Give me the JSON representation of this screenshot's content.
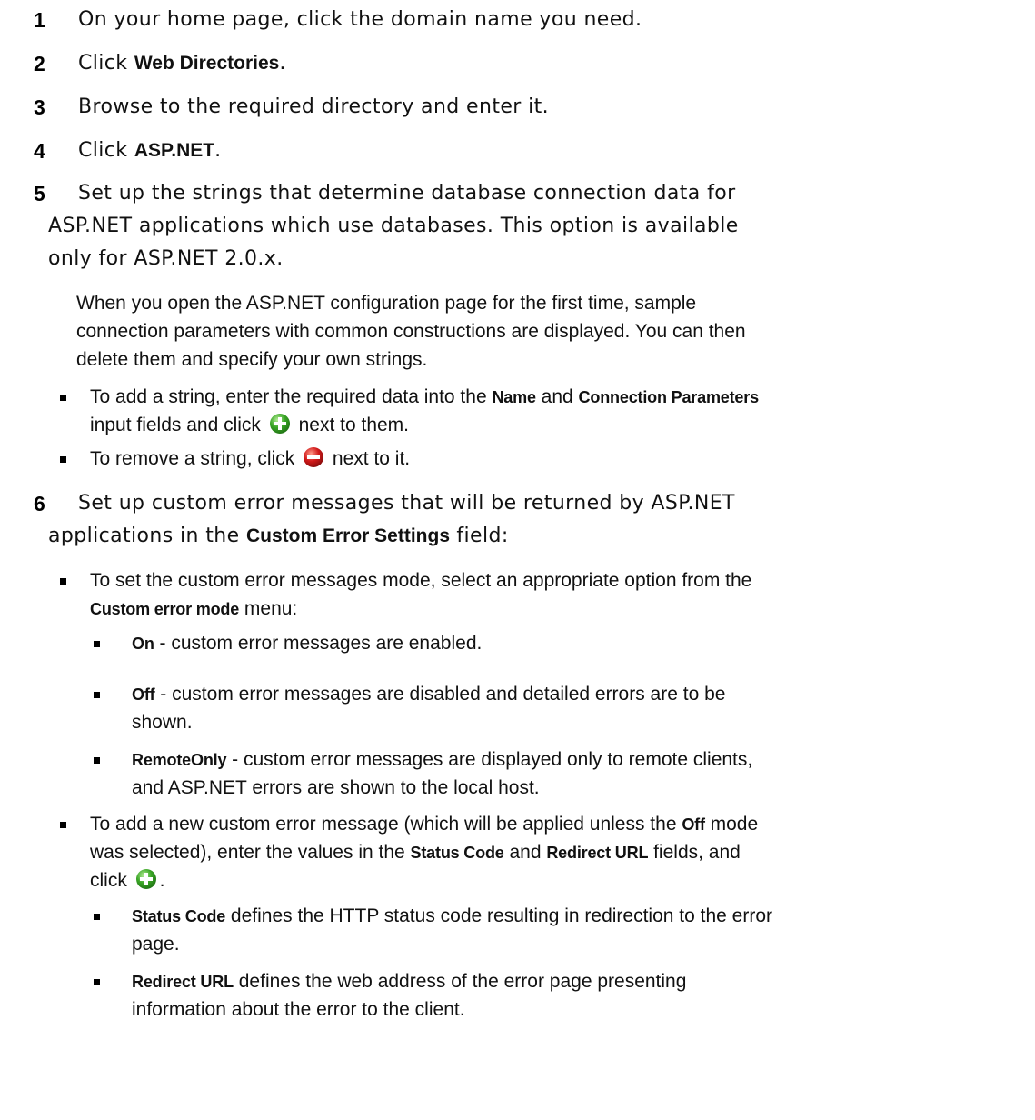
{
  "steps": [
    {
      "number": "1",
      "text": "On your home page, click the domain name you need."
    },
    {
      "number": "2",
      "pre": "Click ",
      "ui": "Web Directories",
      "post": "."
    },
    {
      "number": "3",
      "text": "Browse to the required directory and enter it."
    },
    {
      "number": "4",
      "pre": "Click ",
      "ui": "ASP.NET",
      "post": "."
    },
    {
      "number": "5",
      "lines": [
        "Set up the strings that determine database connection data for",
        "ASP.NET applications which use databases. This option is available",
        "only for ASP.NET 2.0.x."
      ]
    },
    {
      "number": "6",
      "line1": "Set up custom error messages that will be returned by ASP.NET",
      "line2_pre": "applications in the ",
      "line2_ui": "Custom Error Settings",
      "line2_post": " field:"
    }
  ],
  "note5": [
    "When you open the ASP.NET configuration page for the first time, sample",
    "connection parameters with common constructions are displayed. You can then",
    "delete them and specify your own strings."
  ],
  "add_string": {
    "pre": "To add a string, enter the required data into the ",
    "ui1": "Name",
    "mid": " and ",
    "ui2": "Connection Parameters",
    "line2_pre": "input fields and click ",
    "line2_post": " next to them."
  },
  "remove_string": {
    "pre": "To remove a string, click ",
    "post": " next to it."
  },
  "mode": {
    "pre": "To set the custom error messages mode, select an appropriate option from the",
    "ui": "Custom error mode",
    "post": " menu:"
  },
  "mode_options": [
    {
      "name": "On",
      "lines": [
        " - custom error messages are enabled."
      ]
    },
    {
      "name": "Off",
      "lines": [
        " - custom error messages are disabled and detailed errors are to be",
        "shown."
      ]
    },
    {
      "name": "RemoteOnly",
      "lines": [
        " - custom error messages are displayed only to remote clients,",
        "and ASP.NET errors are shown to the local host."
      ]
    }
  ],
  "add_custom": {
    "l1_pre": "To add a new custom error message (which will be applied unless the ",
    "l1_ui": "Off",
    "l1_post": " mode",
    "l2_pre": "was selected), enter the values in the ",
    "l2_ui1": "Status Code",
    "l2_mid": " and ",
    "l2_ui2": "Redirect URL",
    "l2_post": " fields, and",
    "l3_pre": "click ",
    "l3_post": "."
  },
  "fields": [
    {
      "name": "Status Code",
      "lines": [
        " defines the HTTP status code resulting in redirection to the error",
        "page."
      ]
    },
    {
      "name": "Redirect URL",
      "lines": [
        " defines the web address of the error page presenting",
        "information about the error to the client."
      ]
    }
  ],
  "icons": {
    "add": "add-icon",
    "remove": "remove-icon"
  },
  "colors": {
    "add": "#3aa526",
    "remove": "#d21a1a"
  }
}
